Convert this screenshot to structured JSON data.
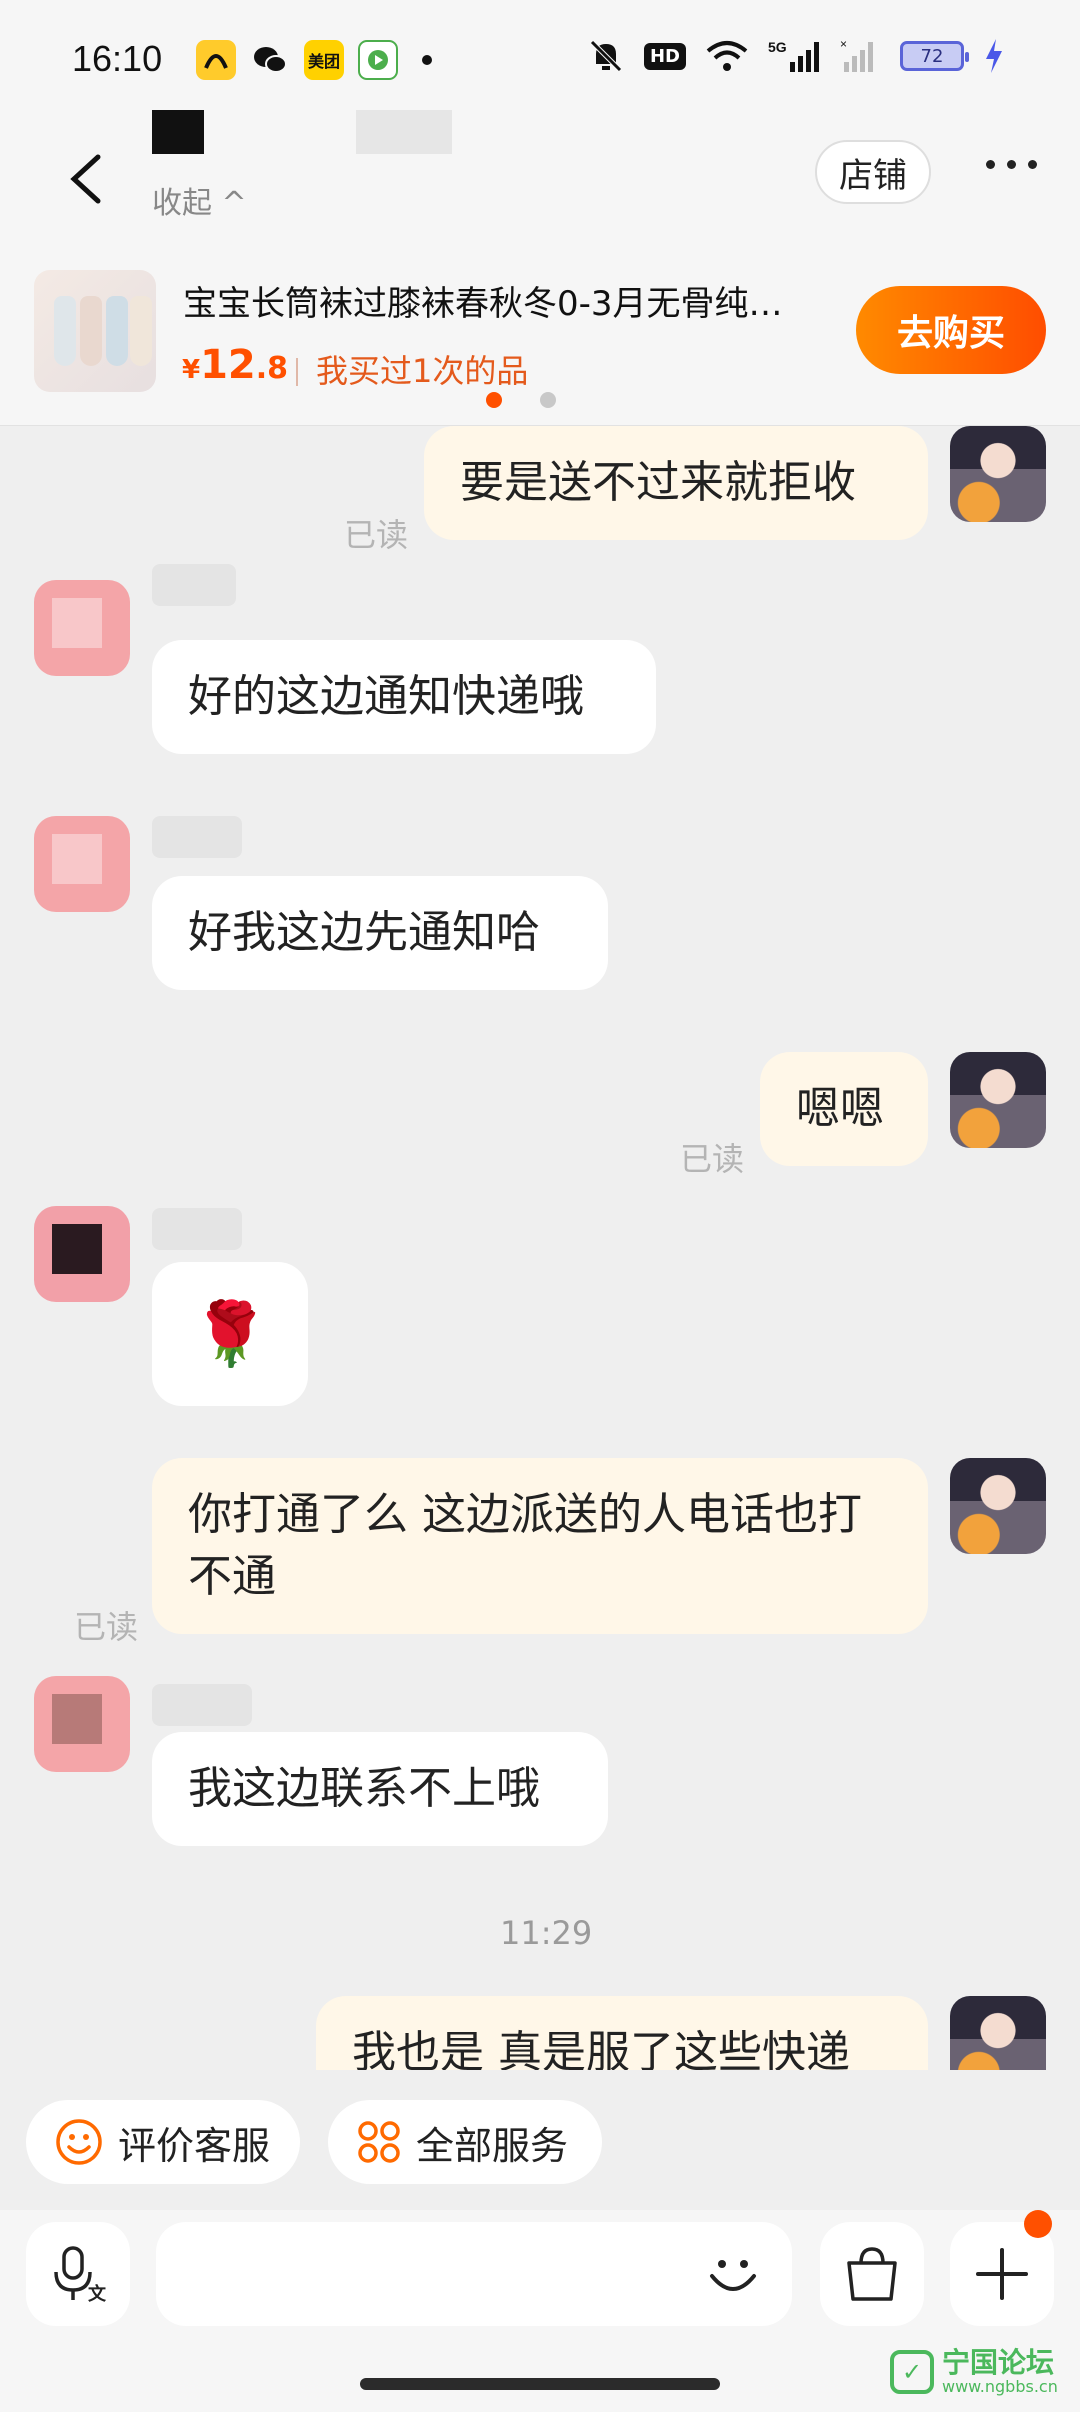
{
  "status_bar": {
    "time": "16:10",
    "apps": [
      "美团"
    ],
    "battery": "72",
    "network": "5G"
  },
  "header": {
    "collapse_label": "收起 ^",
    "shop_label": "店铺"
  },
  "product": {
    "title": "宝宝长筒袜过膝袜春秋冬0-3月无骨纯…",
    "price_currency": "¥",
    "price_int": "12",
    "price_dec": ".8",
    "tag": "我买过1次的品",
    "buy_label": "去购买"
  },
  "messages": {
    "m1": {
      "text": "要是送不过来就拒收",
      "read": "已读"
    },
    "m2": {
      "text": "好的这边通知快递哦"
    },
    "m3": {
      "text": "好我这边先通知哈"
    },
    "m4": {
      "text": "嗯嗯",
      "read": "已读"
    },
    "m5": {
      "emoji": "🌹"
    },
    "m6": {
      "text": "你打通了么 这边派送的人电话也打不通",
      "read": "已读"
    },
    "m7": {
      "text": "我这边联系不上哦"
    },
    "time_divider": "11:29",
    "m8": {
      "text": "我也是 真是服了这些快递"
    }
  },
  "quick_actions": {
    "rate_service": "评价客服",
    "all_services": "全部服务"
  },
  "watermark": {
    "title": "宁国论坛",
    "url": "www.ngbbs.cn"
  },
  "colors": {
    "accent": "#ff5000",
    "outgoing_bubble": "#fff7e8",
    "incoming_bubble": "#ffffff"
  }
}
